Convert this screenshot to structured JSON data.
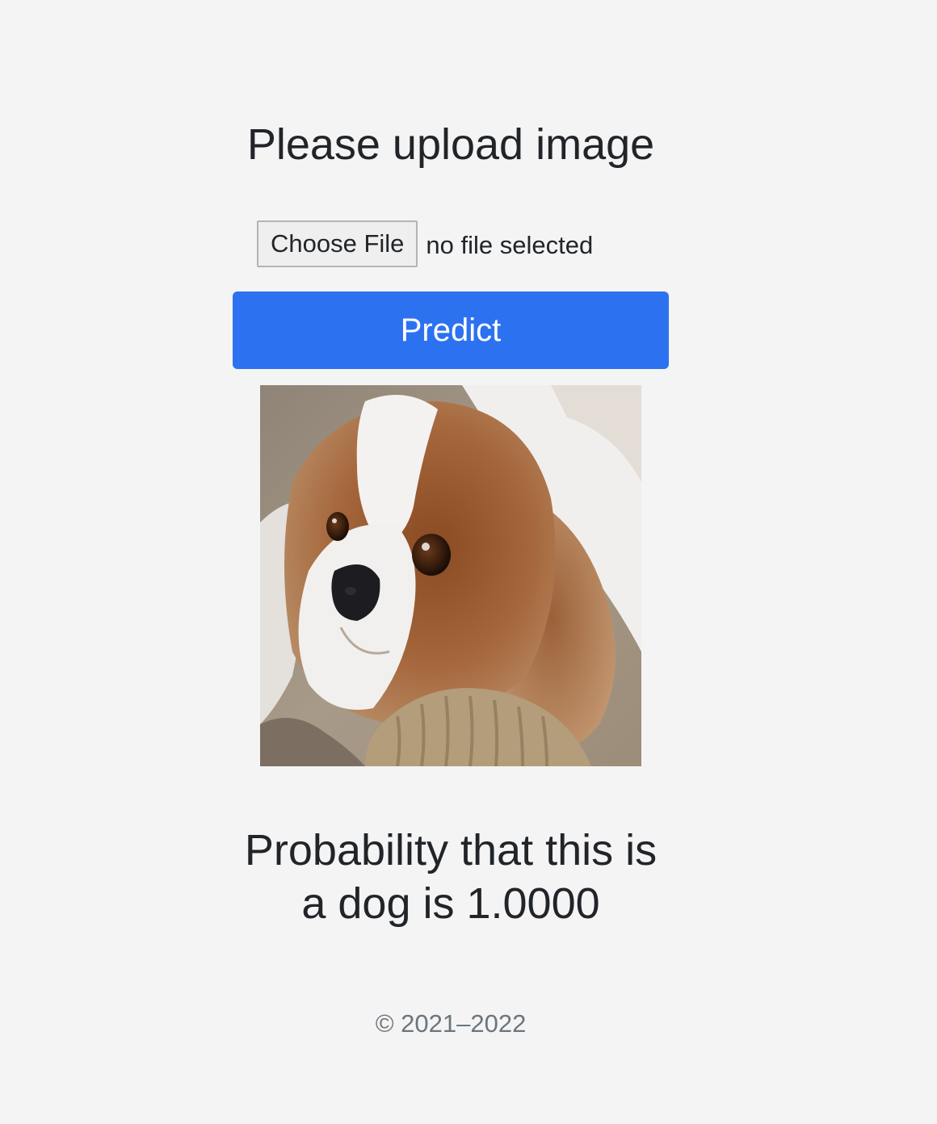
{
  "heading": "Please upload image",
  "file_input": {
    "button_label": "Choose File",
    "status": "no file selected"
  },
  "predict_label": "Predict",
  "result": {
    "line1": "Probability that this is",
    "line2": "a dog is 1.0000"
  },
  "footer": "© 2021–2022",
  "colors": {
    "background": "#f4f4f4",
    "primary": "#2c72f0",
    "text": "#212529",
    "muted": "#6c757d"
  }
}
